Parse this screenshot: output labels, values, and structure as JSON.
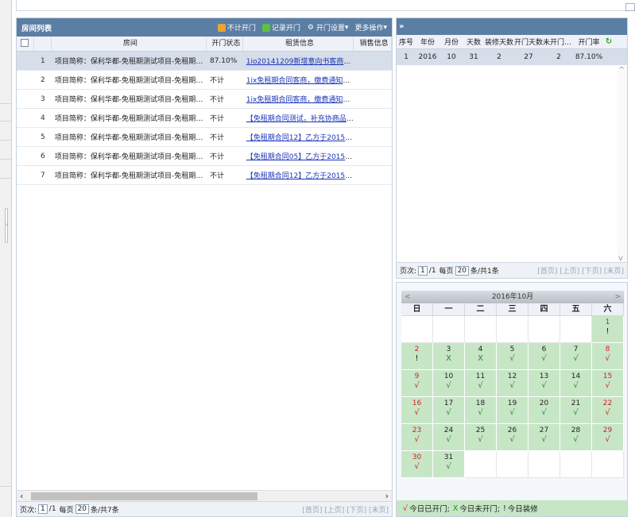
{
  "list_panel": {
    "title": "房间列表",
    "toolbar": [
      {
        "label": "不计开门",
        "icon": "door-icon"
      },
      {
        "label": "记录开门",
        "icon": "record-icon"
      },
      {
        "label": "开门设置",
        "icon": "settings-icon",
        "dropdown": true
      },
      {
        "label": "更多操作",
        "icon": "",
        "dropdown": true
      }
    ],
    "columns": [
      "房间",
      "开门状态",
      "租赁信息",
      "销售信息"
    ],
    "rows": [
      {
        "no": "1",
        "room": "项目简称：保利华都-免租期测试项目-免租期数据用…",
        "status": "87.10%",
        "rent": "1io20141209新增意向书客商，缴…"
      },
      {
        "no": "2",
        "room": "项目简称：保利华都-免租期测试项目-免租期数据用…",
        "status": "不计",
        "rent": "1ix免租期合同客商，缴费通知单…"
      },
      {
        "no": "3",
        "room": "项目简称：保利华都-免租期测试项目-免租期数据用…",
        "status": "不计",
        "rent": "1ix免租期合同客商，缴费通知单…"
      },
      {
        "no": "4",
        "room": "项目简称：保利华都-免租期测试项目-免租期数据用…",
        "status": "不计",
        "rent": "【免租期合同测试，补充协商品抽…"
      },
      {
        "no": "5",
        "room": "项目简称：保利华都-免租期测试项目-免租期数据用…",
        "status": "不计",
        "rent": "【免租期合同12】乙方于2015-02-…"
      },
      {
        "no": "6",
        "room": "项目简称：保利华都-免租期测试项目-免租期数据用…",
        "status": "不计",
        "rent": "【免租期合同05】乙方于2015-02-…"
      },
      {
        "no": "7",
        "room": "项目简称：保利华都-免租期测试项目-免租期数据用…",
        "status": "不计",
        "rent": "【免租期合同12】乙方于2015-02-…"
      }
    ],
    "pager": {
      "page_label": "页次:",
      "page": "1",
      "total_pages": "/1",
      "per_page_label": "每页",
      "per_page": "20",
      "summary": "条/共7条",
      "nav": "[首页] [上页] [下页] [末页]"
    }
  },
  "stats_panel": {
    "expand": "»",
    "columns": [
      "序号",
      "年份",
      "月份",
      "天数",
      "装修天数",
      "开门天数",
      "未开门天数",
      "开门率"
    ],
    "rows": [
      {
        "no": "1",
        "year": "2016",
        "month": "10",
        "days": "31",
        "deco": "2",
        "open": "27",
        "closed": "2",
        "rate": "87.10%"
      }
    ],
    "refresh_icon": "refresh-icon",
    "pager": {
      "page_label": "页次:",
      "page": "1",
      "total_pages": "/1",
      "per_page_label": "每页",
      "per_page": "20",
      "summary": "条/共1条",
      "nav": "[首页] [上页] [下页] [末页]"
    }
  },
  "calendar": {
    "title": "2016年10月",
    "prev": "<",
    "next": ">",
    "weekdays": [
      "日",
      "一",
      "二",
      "三",
      "四",
      "五",
      "六"
    ],
    "leading_blanks": 6,
    "days": [
      {
        "d": "1",
        "m": "!"
      },
      {
        "d": "2",
        "m": "!"
      },
      {
        "d": "3",
        "m": "X"
      },
      {
        "d": "4",
        "m": "X"
      },
      {
        "d": "5",
        "m": "√"
      },
      {
        "d": "6",
        "m": "√"
      },
      {
        "d": "7",
        "m": "√"
      },
      {
        "d": "8",
        "m": "√"
      },
      {
        "d": "9",
        "m": "√"
      },
      {
        "d": "10",
        "m": "√"
      },
      {
        "d": "11",
        "m": "√"
      },
      {
        "d": "12",
        "m": "√"
      },
      {
        "d": "13",
        "m": "√"
      },
      {
        "d": "14",
        "m": "√"
      },
      {
        "d": "15",
        "m": "√"
      },
      {
        "d": "16",
        "m": "√"
      },
      {
        "d": "17",
        "m": "√"
      },
      {
        "d": "18",
        "m": "√"
      },
      {
        "d": "19",
        "m": "√"
      },
      {
        "d": "20",
        "m": "√"
      },
      {
        "d": "21",
        "m": "√"
      },
      {
        "d": "22",
        "m": "√"
      },
      {
        "d": "23",
        "m": "√"
      },
      {
        "d": "24",
        "m": "√"
      },
      {
        "d": "25",
        "m": "√"
      },
      {
        "d": "26",
        "m": "√"
      },
      {
        "d": "27",
        "m": "√"
      },
      {
        "d": "28",
        "m": "√"
      },
      {
        "d": "29",
        "m": "√"
      },
      {
        "d": "30",
        "m": "√"
      },
      {
        "d": "31",
        "m": "√"
      }
    ],
    "legend": [
      {
        "mark": "√",
        "text": "今日已开门;",
        "color": "#d12222"
      },
      {
        "mark": "X",
        "text": "今日未开门;",
        "color": "#1e8c1e"
      },
      {
        "mark": "!",
        "text": "今日装修",
        "color": "#222222"
      }
    ]
  },
  "colors": {
    "header": "#5b7ea5",
    "selected_row": "#d6deea",
    "calendar_on": "#c6e6c6",
    "weekend": "#d12222",
    "link": "#1b34b8"
  }
}
